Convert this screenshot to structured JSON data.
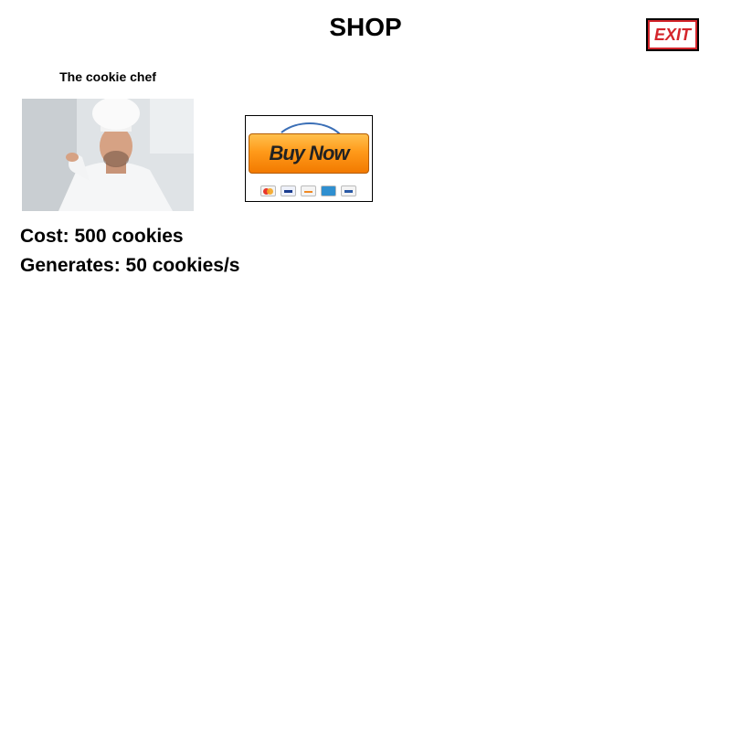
{
  "header": {
    "title": "SHOP",
    "exit_label": "EXIT"
  },
  "item": {
    "name": "The cookie chef",
    "cost": "Cost: 500 cookies",
    "generates": "Generates: 50 cookies/s"
  },
  "buy": {
    "label": "Buy Now",
    "payment_icons": [
      "mastercard-icon",
      "visa-icon",
      "discover-icon",
      "amex-icon",
      "paypal-icon"
    ]
  },
  "colors": {
    "exit_red": "#d4252b",
    "buy_orange": "#ff9a1a"
  }
}
